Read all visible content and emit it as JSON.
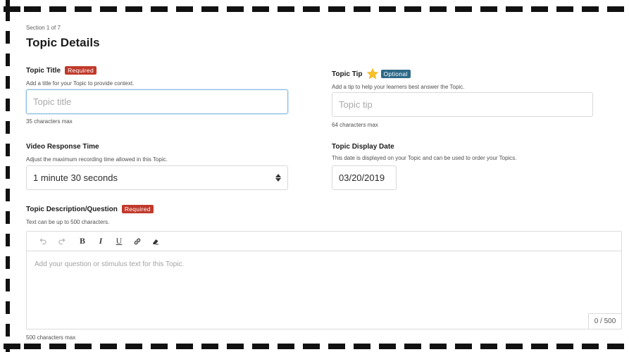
{
  "section": {
    "progress_label": "Section 1 of 7",
    "title": "Topic Details"
  },
  "topic_title": {
    "label": "Topic Title",
    "badge": "Required",
    "help": "Add a title for your Topic to provide context.",
    "placeholder": "Topic title",
    "value": "",
    "limit": "35 characters max"
  },
  "topic_tip": {
    "label": "Topic Tip",
    "badge": "Optional",
    "help": "Add a tip to help your learners best answer the Topic.",
    "placeholder": "Topic tip",
    "value": "",
    "limit": "64 characters max"
  },
  "video_response_time": {
    "label": "Video Response Time",
    "help": "Adjust the maximum recording time allowed in this Topic.",
    "selected": "1 minute 30 seconds"
  },
  "display_date": {
    "label": "Topic Display Date",
    "help": "This date is displayed on your Topic and can be used to order your Topics.",
    "value": "03/20/2019"
  },
  "description": {
    "label": "Topic Description/Question",
    "badge": "Required",
    "help": "Text can be up to 500 characters.",
    "placeholder": "Add your question or stimulus text for this Topic.",
    "counter": "0 / 500",
    "limit": "500 characters max",
    "toolbar": {
      "undo_icon": "undo-icon",
      "redo_icon": "redo-icon",
      "bold": "B",
      "italic": "I",
      "underline": "U",
      "link_icon": "link-icon",
      "clear_format_icon": "eraser-icon"
    }
  },
  "colors": {
    "required_badge": "#c0392b",
    "optional_badge": "#2e6a88",
    "focus_border": "#89bde0",
    "star": "#f5c02a"
  }
}
